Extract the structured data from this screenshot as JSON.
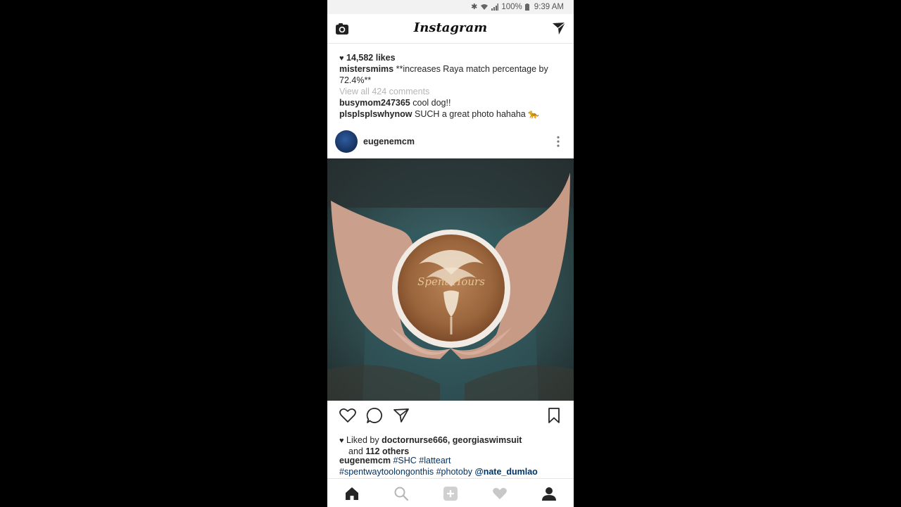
{
  "status_bar": {
    "battery": "100%",
    "time": "9:39 AM"
  },
  "header": {
    "title": "Instagram",
    "left_icon": "camera-icon",
    "right_icon": "direct-send-icon"
  },
  "previous_post": {
    "likes": "14,582 likes",
    "caption_user": "mistersmims",
    "caption_text": "**increases Raya match percentage by 72.4%**",
    "view_comments": "View all 424 comments",
    "comments": [
      {
        "user": "busymom247365",
        "text": "cool dog!!"
      },
      {
        "user": "plsplsplswhynow",
        "text": "SUCH a great photo hahaha 🐆"
      }
    ]
  },
  "post": {
    "username": "eugenemcm",
    "image_alt": "latte art in hands",
    "watermark": "Spent Hours",
    "liked_by_prefix": "Liked by",
    "liked_by_users": "doctornurse666, georgiaswimsuit",
    "liked_by_and": "and",
    "liked_by_others": "112 others",
    "caption_user": "eugenemcm",
    "tag_shc": "#SHC",
    "tag_latteart": "#latteart",
    "tag_spent": "#spentwaytoolongonthis",
    "tag_photoby": "#photoby",
    "mention": "@nate_dumlao"
  },
  "actions": [
    "heart-icon",
    "comment-icon",
    "share-icon",
    "bookmark-icon"
  ],
  "bottom_nav": [
    "home-icon",
    "search-icon",
    "add-icon",
    "activity-icon",
    "profile-icon"
  ],
  "colors": {
    "link": "#003569",
    "muted": "#b5b5b5",
    "text": "#262626"
  }
}
